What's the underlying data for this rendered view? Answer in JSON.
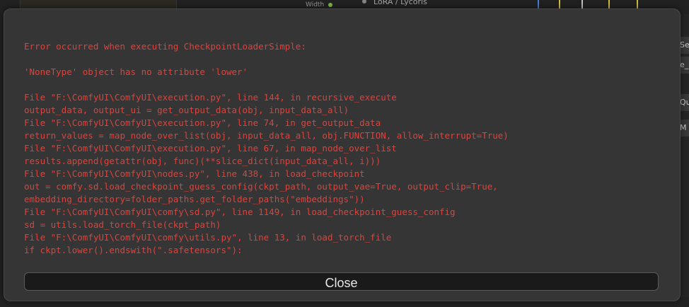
{
  "background": {
    "width_label": "Width",
    "lora_label": "LoRA / Lycoris",
    "right_panel_items": [
      "Sel",
      "e_",
      "Qua",
      "M"
    ]
  },
  "error_dialog": {
    "lines": [
      "Error occurred when executing CheckpointLoaderSimple:",
      "",
      "'NoneType' object has no attribute 'lower'",
      "",
      "File \"F:\\ComfyUI\\ComfyUI\\execution.py\", line 144, in recursive_execute",
      "output_data, output_ui = get_output_data(obj, input_data_all)",
      "File \"F:\\ComfyUI\\ComfyUI\\execution.py\", line 74, in get_output_data",
      "return_values = map_node_over_list(obj, input_data_all, obj.FUNCTION, allow_interrupt=True)",
      "File \"F:\\ComfyUI\\ComfyUI\\execution.py\", line 67, in map_node_over_list",
      "results.append(getattr(obj, func)(**slice_dict(input_data_all, i)))",
      "File \"F:\\ComfyUI\\ComfyUI\\nodes.py\", line 438, in load_checkpoint",
      "out = comfy.sd.load_checkpoint_guess_config(ckpt_path, output_vae=True, output_clip=True,",
      "embedding_directory=folder_paths.get_folder_paths(\"embeddings\"))",
      "File \"F:\\ComfyUI\\ComfyUI\\comfy\\sd.py\", line 1149, in load_checkpoint_guess_config",
      "sd = utils.load_torch_file(ckpt_path)",
      "File \"F:\\ComfyUI\\ComfyUI\\comfy\\utils.py\", line 13, in load_torch_file",
      "if ckpt.lower().endswith(\".safetensors\"):"
    ],
    "close_label": "Close",
    "error_color": "#e0413a"
  }
}
